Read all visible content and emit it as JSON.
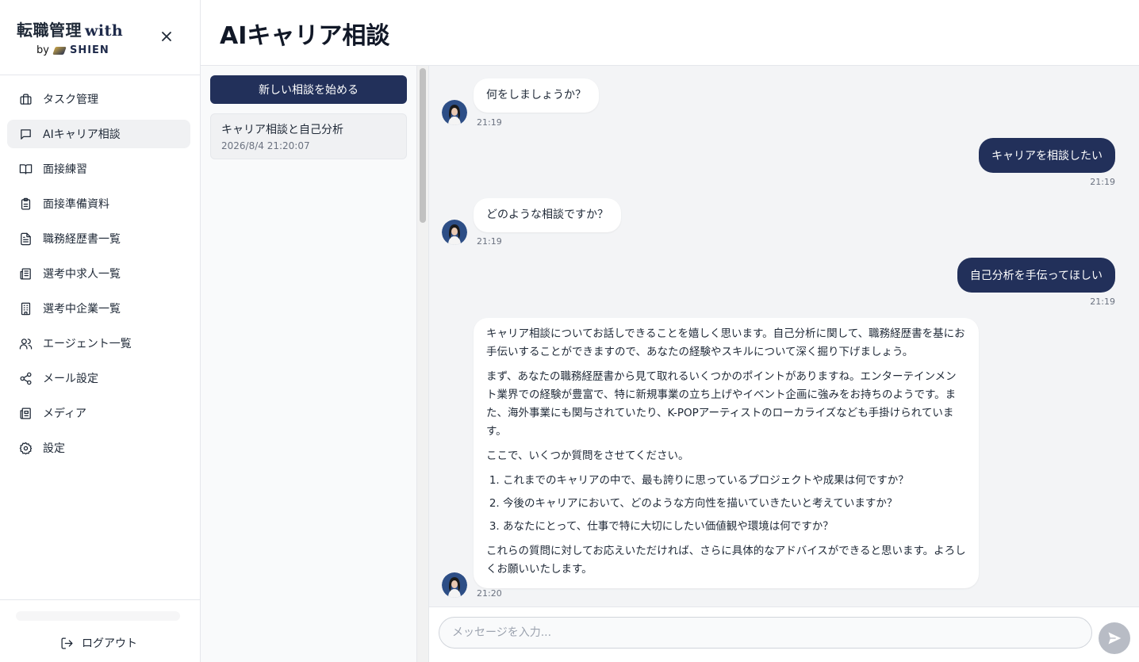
{
  "brand": {
    "title": "転職管理",
    "with": "with",
    "by": "by",
    "company": "SHIEN"
  },
  "sidebar": {
    "items": [
      {
        "label": "タスク管理",
        "icon": "briefcase-icon"
      },
      {
        "label": "AIキャリア相談",
        "icon": "chat-icon",
        "active": true
      },
      {
        "label": "面接練習",
        "icon": "book-open-icon"
      },
      {
        "label": "面接準備資料",
        "icon": "clipboard-icon"
      },
      {
        "label": "職務経歴書一覧",
        "icon": "file-text-icon"
      },
      {
        "label": "選考中求人一覧",
        "icon": "newspaper-icon"
      },
      {
        "label": "選考中企業一覧",
        "icon": "building-icon"
      },
      {
        "label": "エージェント一覧",
        "icon": "users-icon"
      },
      {
        "label": "メール設定",
        "icon": "share-icon"
      },
      {
        "label": "メディア",
        "icon": "media-icon"
      },
      {
        "label": "設定",
        "icon": "gear-icon"
      }
    ],
    "logout_label": "ログアウト"
  },
  "header": {
    "title": "AIキャリア相談"
  },
  "threads": {
    "new_button": "新しい相談を始める",
    "items": [
      {
        "title": "キャリア相談と自己分析",
        "date": "2026/8/4 21:20:07"
      }
    ]
  },
  "chat": {
    "messages": [
      {
        "role": "ai",
        "text": "何をしましょうか？",
        "time": "21:19"
      },
      {
        "role": "user",
        "text": "キャリアを相談したい",
        "time": "21:19"
      },
      {
        "role": "ai",
        "text": "どのような相談ですか？",
        "time": "21:19"
      },
      {
        "role": "user",
        "text": "自己分析を手伝ってほしい",
        "time": "21:19"
      },
      {
        "role": "ai",
        "time": "21:20",
        "paragraphs": [
          "キャリア相談についてお話しできることを嬉しく思います。自己分析に関して、職務経歴書を基にお手伝いすることができますので、あなたの経験やスキルについて深く掘り下げましょう。",
          "まず、あなたの職務経歴書から見て取れるいくつかのポイントがありますね。エンターテインメント業界での経験が豊富で、特に新規事業の立ち上げやイベント企画に強みをお持ちのようです。また、海外事業にも関与されていたり、K-POPアーティストのローカライズなども手掛けられています。",
          "ここで、いくつか質問をさせてください。"
        ],
        "list": [
          "これまでのキャリアの中で、最も誇りに思っているプロジェクトや成果は何ですか？",
          "今後のキャリアにおいて、どのような方向性を描いていきたいと考えていますか？",
          "あなたにとって、仕事で特に大切にしたい価値観や環境は何ですか？"
        ],
        "closing": "これらの質問に対してお応えいただければ、さらに具体的なアドバイスができると思います。よろしくお願いいたします。"
      }
    ]
  },
  "input": {
    "placeholder": "メッセージを入力...",
    "value": ""
  },
  "colors": {
    "primary": "#22305a",
    "chat_bg": "#f3f4f6",
    "active_nav": "#f0f1f3"
  }
}
